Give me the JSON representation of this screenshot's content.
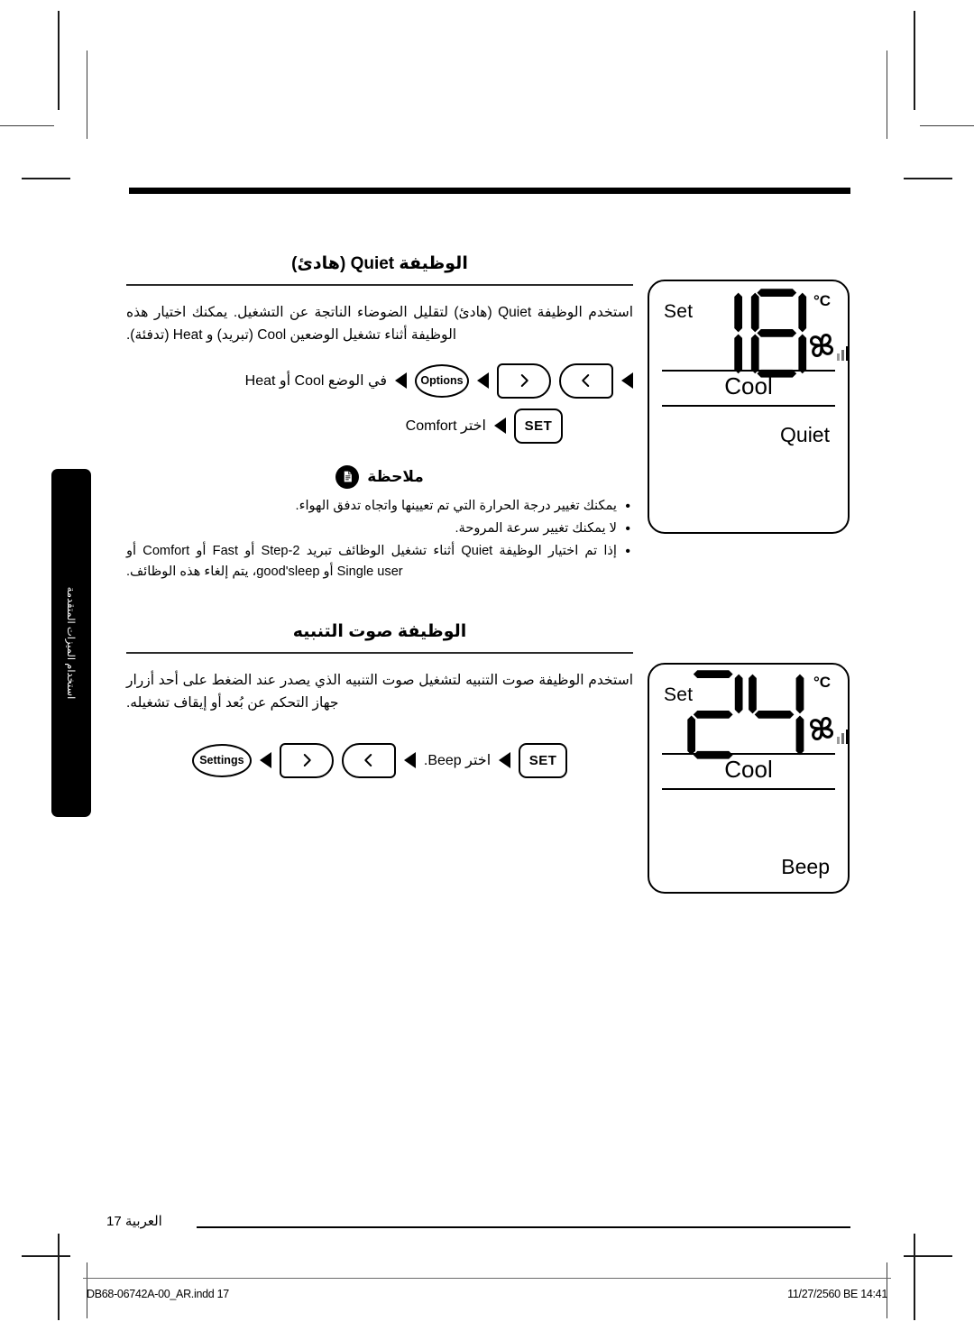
{
  "page": {
    "language": "ar",
    "number_label": "العربية 17",
    "side_tab_text": "استخدام الميزات المتقدمة"
  },
  "sections": [
    {
      "id": "quiet",
      "heading": "الوظيفة Quiet (هادئ)",
      "body": "استخدم الوظيفة Quiet (هادئ) لتقليل الضوضاء الناتجة عن التشغيل. يمكنك اختيار هذه الوظيفة أثناء تشغيل الوضعين Cool (تبريد) و Heat (تدفئة).",
      "steps": [
        {
          "label": "في الوضع Cool أو Heat",
          "buttons": [
            {
              "name": "options-button",
              "text": "Options",
              "shape": "oval"
            },
            {
              "name": "right-arrow-button",
              "text": "",
              "shape": "d-right",
              "icon": "chevron-right-icon"
            },
            {
              "name": "left-arrow-button",
              "text": "",
              "shape": "d-left",
              "icon": "chevron-left-icon"
            }
          ]
        },
        {
          "label": "اختر Comfort",
          "buttons": [
            {
              "name": "set-button",
              "text": "SET",
              "shape": "rect"
            }
          ]
        }
      ]
    },
    {
      "id": "beep",
      "heading": "الوظيفة صوت التنبيه",
      "body": "استخدم الوظيفة صوت التنبيه لتشغيل صوت التنبيه الذي يصدر عند الضغط على أحد أزرار جهاز التحكم عن بُعد أو إيقاف تشغيله.",
      "steps": [
        {
          "label": "اختر Beep.",
          "buttons": [
            {
              "name": "settings-button",
              "text": "Settings",
              "shape": "oval"
            },
            {
              "name": "right-arrow-button",
              "text": "",
              "shape": "d-right",
              "icon": "chevron-right-icon"
            },
            {
              "name": "left-arrow-button",
              "text": "",
              "shape": "d-left",
              "icon": "chevron-left-icon"
            },
            {
              "name": "set-button",
              "text": "SET",
              "shape": "rect"
            }
          ]
        }
      ]
    }
  ],
  "note": {
    "icon": "note-document-icon",
    "title": "ملاحظة",
    "items": [
      "يمكنك تغيير درجة الحرارة التي تم تعيينها واتجاه تدفق الهواء.",
      "لا يمكنك تغيير سرعة المروحة.",
      "إذا تم اختيار الوظيفة Quiet أثناء تشغيل الوظائف تبريد 2-Step أو Fast أو Comfort أو Single user أو good'sleep، يتم إلغاء هذه الوظائف."
    ]
  },
  "displays": [
    {
      "id": "display-quiet",
      "set_label": "Set",
      "temperature": "18",
      "unit": "°C",
      "fan_icon": "fan-icon",
      "fan_bars": 3,
      "mode": "Cool",
      "feature": "Quiet"
    },
    {
      "id": "display-beep",
      "set_label": "Set",
      "temperature": "24",
      "unit": "°C",
      "fan_icon": "fan-icon",
      "fan_bars": 3,
      "mode": "Cool",
      "feature": "Beep"
    }
  ],
  "footer": {
    "file_name": "DB68-06742A-00_AR.indd   17",
    "timestamp": "11/27/2560 BE   14:41"
  }
}
